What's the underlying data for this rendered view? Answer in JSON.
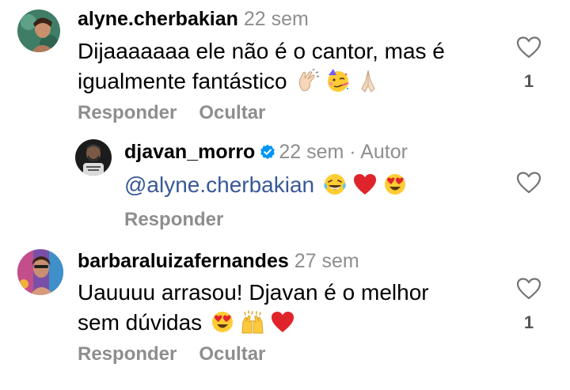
{
  "comments": [
    {
      "username": "alyne.cherbakian",
      "time": "22 sem",
      "text_line1": "Dijaaaaaaa ele não é o cantor, mas é",
      "text_line2": "igualmente fantástico",
      "emojis": [
        "clapping-hands-emoji",
        "partying-face-emoji",
        "folded-hands-emoji"
      ],
      "likes": "1",
      "reply_label": "Responder",
      "hide_label": "Ocultar"
    },
    {
      "username": "djavan_morro",
      "verified": true,
      "time": "22 sem",
      "author_tag": "· Autor",
      "mention": "@alyne.cherbakian",
      "emojis": [
        "laughing-tears-emoji",
        "red-heart-emoji",
        "heart-eyes-emoji"
      ],
      "reply_label": "Responder"
    },
    {
      "username": "barbaraluizafernandes",
      "time": "27 sem",
      "text_line1": "Uauuuu arrasou! Djavan é o melhor",
      "text_line2": "sem dúvidas",
      "emojis": [
        "heart-eyes-emoji",
        "raising-hands-emoji",
        "red-heart-emoji"
      ],
      "likes": "1",
      "reply_label": "Responder",
      "hide_label": "Ocultar"
    }
  ],
  "colors": {
    "username": "#000000",
    "meta": "#8e8e8e",
    "mention": "#385898",
    "verified": "#0095f6"
  }
}
